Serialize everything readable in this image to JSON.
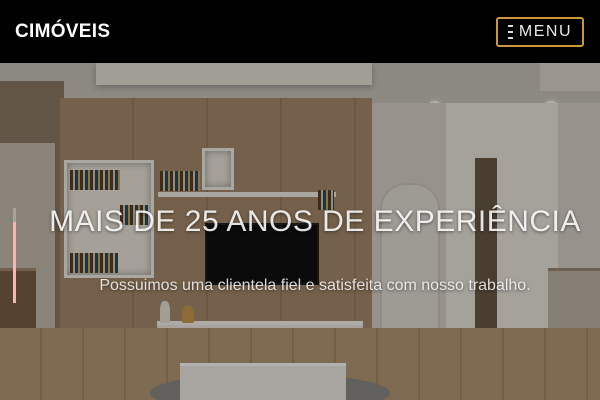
{
  "navbar": {
    "brand": "CIMÓVEIS",
    "menu_label": "MENU"
  },
  "hero": {
    "title": "MAIS DE 25 ANOS DE EXPERIÊNCIA",
    "subtitle": "Possuimos uma clientela fiel e satisfeita com nosso trabalho."
  },
  "icons": {
    "menu": "hamburger-icon"
  },
  "colors": {
    "navbar_bg": "#000000",
    "menu_border": "#c9963a",
    "scroll_thumb": "#f2b8b8"
  }
}
